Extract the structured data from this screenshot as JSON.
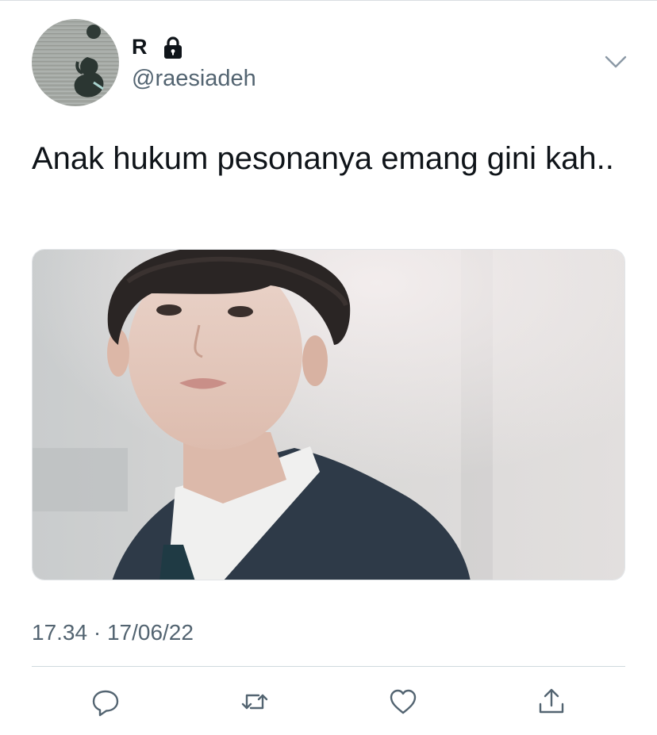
{
  "tweet": {
    "author": {
      "display_name": "R",
      "handle": "@raesiadeh",
      "protected": true
    },
    "text": "Anak hukum pesonanya emang gini kah..",
    "timestamp": "17.34 · 17/06/22",
    "media_description": "photo"
  },
  "icons": {
    "lock": "lock-icon",
    "more": "chevron-down-icon",
    "reply": "reply-icon",
    "retweet": "retweet-icon",
    "like": "heart-icon",
    "share": "share-icon"
  },
  "colors": {
    "text_primary": "#0f1419",
    "text_secondary": "#536471",
    "icon": "#536471",
    "divider": "#cfd9de"
  }
}
